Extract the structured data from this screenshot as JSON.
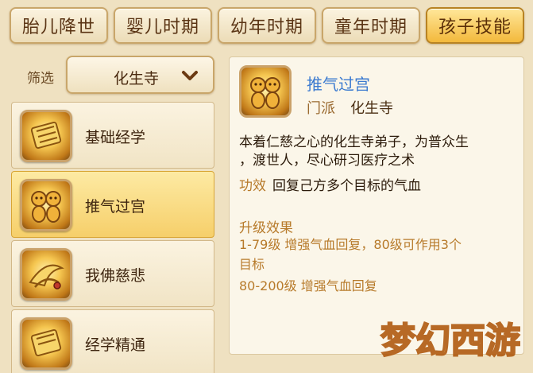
{
  "tabs": [
    {
      "label": "胎儿降世",
      "active": false
    },
    {
      "label": "婴儿时期",
      "active": false
    },
    {
      "label": "幼年时期",
      "active": false
    },
    {
      "label": "童年时期",
      "active": false
    },
    {
      "label": "孩子技能",
      "active": true
    }
  ],
  "filter": {
    "label": "筛选",
    "value": "化生寺",
    "icon": "chevron-down-icon"
  },
  "skills": [
    {
      "name": "基础经学",
      "icon": "scroll-skill-icon",
      "active": false
    },
    {
      "name": "推气过宫",
      "icon": "twin-figures-skill-icon",
      "active": true
    },
    {
      "name": "我佛慈悲",
      "icon": "lotus-swirl-skill-icon",
      "active": false
    },
    {
      "name": "经学精通",
      "icon": "scroll-skill-icon",
      "active": false
    }
  ],
  "detail": {
    "title": "推气过宫",
    "school_label": "门派",
    "school_value": "化生寺",
    "description_lines": [
      "本着仁慈之心的化生寺弟子，为普众生",
      "，渡世人，尽心研习医疗之术"
    ],
    "effect_label": "功效",
    "effect_value": "回复己方多个目标的气血",
    "upgrade_title": "升级效果",
    "upgrade_lines": [
      "1-79级 增强气血回复，80级可作用3个",
      "目标",
      "80-200级 增强气血回复"
    ]
  },
  "watermark": {
    "text": "梦幻西游"
  },
  "colors": {
    "active_tab": "#f3b93c",
    "link_blue": "#3b7ad0",
    "label_gold": "#b77a2a"
  }
}
